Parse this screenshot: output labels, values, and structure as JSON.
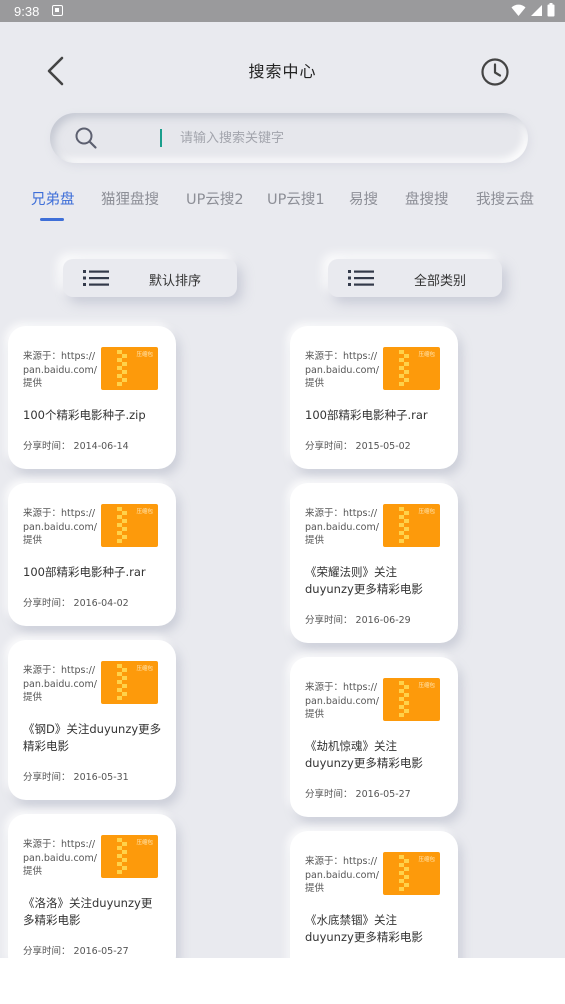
{
  "status_bar": {
    "time": "9:38"
  },
  "header": {
    "title": "搜索中心"
  },
  "search": {
    "placeholder": "请输入搜索关键字",
    "value": ""
  },
  "tabs": [
    "兄弟盘",
    "猫狸盘搜",
    "UP云搜2",
    "UP云搜1",
    "易搜",
    "盘搜搜",
    "我搜云盘"
  ],
  "active_tab": "兄弟盘",
  "sort_button": {
    "label": "默认排序"
  },
  "category_button": {
    "label": "全部类别"
  },
  "thumb_label": "压缩包",
  "results": [
    {
      "source": "来源于：https://pan.baidu.com/提供",
      "name": "100个精彩电影种子.zip",
      "date": "分享时间：  2014-06-14"
    },
    {
      "source": "来源于：https://pan.baidu.com/提供",
      "name": "100部精彩电影种子.rar",
      "date": "分享时间：  2015-05-02"
    },
    {
      "source": "来源于：https://pan.baidu.com/提供",
      "name": "100部精彩电影种子.rar",
      "date": "分享时间：  2016-04-02"
    },
    {
      "source": "来源于：https://pan.baidu.com/提供",
      "name": "《荣耀法则》关注duyunzy更多精彩电影",
      "date": "分享时间：  2016-06-29"
    },
    {
      "source": "来源于：https://pan.baidu.com/提供",
      "name": "《钢D》关注duyunzy更多精彩电影",
      "date": "分享时间：  2016-05-31"
    },
    {
      "source": "来源于：https://pan.baidu.com/提供",
      "name": "《劫机惊魂》关注duyunzy更多精彩电影",
      "date": "分享时间：  2016-05-27"
    },
    {
      "source": "来源于：https://pan.baidu.com/提供",
      "name": "《洛洛》关注duyunzy更多精彩电影",
      "date": "分享时间：  2016-05-27"
    },
    {
      "source": "来源于：https://pan.baidu.com/提供",
      "name": "《水底禁锢》关注duyunzy更多精彩电影",
      "date": ""
    }
  ],
  "colors": {
    "accent": "#3e6fd8",
    "thumb": "#fd9a0b",
    "background": "#e9eaef",
    "cursor": "#1a9e8c"
  },
  "icons": {
    "back": "chevron-left-icon",
    "history": "clock-icon",
    "search": "search-icon",
    "list": "list-icon",
    "file": "zip-file-icon"
  }
}
